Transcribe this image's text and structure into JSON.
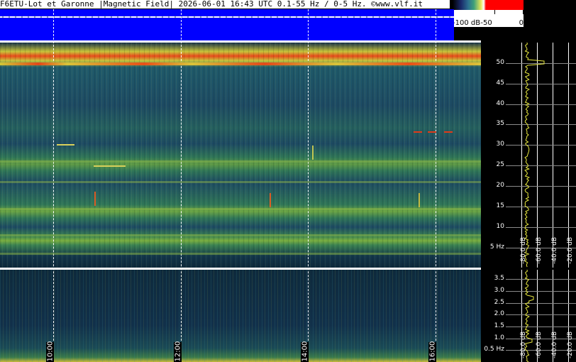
{
  "title": "F6ETU-Lot et Garonne |Magnetic Field| 2026-06-01 16:43 UTC 0.1-55 Hz / 0-5 Hz. ©www.vlf.it",
  "colorbar": {
    "ticks": [
      {
        "label": "-100 dB",
        "pos": 0
      },
      {
        "label": "-50",
        "pos": 0.6
      },
      {
        "label": "0",
        "pos": 1
      }
    ],
    "colors": [
      "#000000",
      "#2d7090",
      "#3ea07a",
      "#e8e85a",
      "#ffffff",
      "#ff0000"
    ]
  },
  "chart_data": [
    {
      "type": "heatmap",
      "name": "upper-spectrogram",
      "title": "",
      "xlabel": "",
      "ylabel": "",
      "x_ticks": [
        "10:00",
        "12:00",
        "14:00",
        "16:00"
      ],
      "y_ticks": [
        {
          "label": "50",
          "value": 50
        },
        {
          "label": "45",
          "value": 45
        },
        {
          "label": "40",
          "value": 40
        },
        {
          "label": "35",
          "value": 35
        },
        {
          "label": "30",
          "value": 30
        },
        {
          "label": "25",
          "value": 25
        },
        {
          "label": "20",
          "value": 20
        },
        {
          "label": "15",
          "value": 15
        },
        {
          "label": "10",
          "value": 10
        },
        {
          "label": "5 Hz",
          "value": 5
        }
      ],
      "ylim": [
        0.1,
        55
      ],
      "bright_lines_hz": [
        50,
        26,
        21,
        14.5,
        8,
        3.5
      ],
      "strongest_line_hz": 50,
      "profile_db_ticks": [
        "-80.0 dB",
        "-60.0 dB",
        "-40.0 dB",
        "-20.0 dB"
      ]
    },
    {
      "type": "heatmap",
      "name": "lower-spectrogram",
      "title": "",
      "xlabel": "",
      "ylabel": "",
      "x_ticks": [
        "10:00",
        "12:00",
        "14:00",
        "16:00"
      ],
      "y_ticks": [
        {
          "label": "3.5",
          "value": 3.5
        },
        {
          "label": "3.0",
          "value": 3.0
        },
        {
          "label": "2.5",
          "value": 2.5
        },
        {
          "label": "2.0",
          "value": 2.0
        },
        {
          "label": "1.5",
          "value": 1.5
        },
        {
          "label": "1.0",
          "value": 1.0
        },
        {
          "label": "0.5 Hz",
          "value": 0.5
        }
      ],
      "ylim": [
        0,
        3.9
      ],
      "profile_db_ticks": [
        "-80.0 dB",
        "-60.0 dB",
        "-40.0 dB",
        "-20.0 dB"
      ]
    }
  ]
}
